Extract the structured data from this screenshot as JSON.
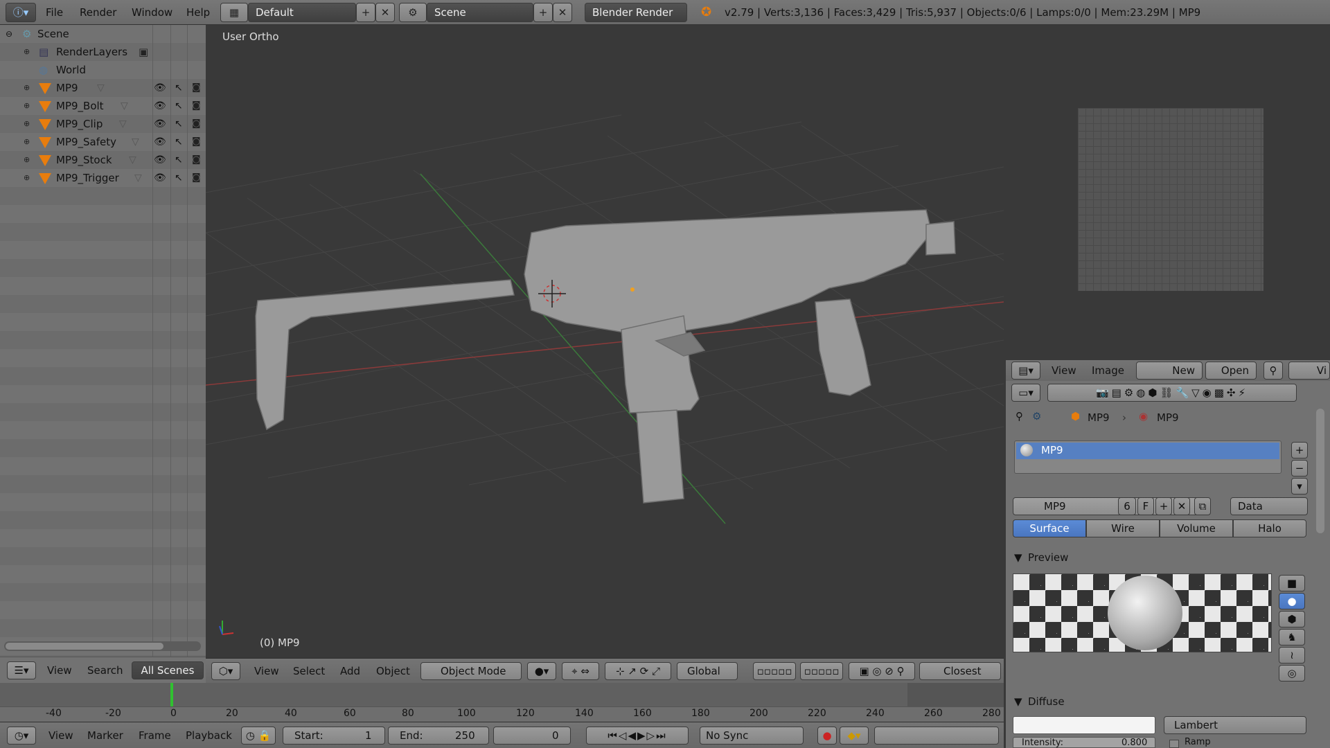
{
  "menu": {
    "file": "File",
    "render": "Render",
    "window": "Window",
    "help": "Help"
  },
  "layout": {
    "name": "Default"
  },
  "scene": {
    "name": "Scene"
  },
  "engine": {
    "name": "Blender Render"
  },
  "stats": "v2.79 | Verts:3,136 | Faces:3,429 | Tris:5,937 | Objects:0/6 | Lamps:0/0 | Mem:23.29M | MP9",
  "outliner": {
    "items": [
      {
        "label": "Scene"
      },
      {
        "label": "RenderLayers"
      },
      {
        "label": "World"
      },
      {
        "label": "MP9"
      },
      {
        "label": "MP9_Bolt"
      },
      {
        "label": "MP9_Clip"
      },
      {
        "label": "MP9_Safety"
      },
      {
        "label": "MP9_Stock"
      },
      {
        "label": "MP9_Trigger"
      }
    ],
    "footer": {
      "view": "View",
      "search": "Search",
      "filter": "All Scenes"
    }
  },
  "viewport": {
    "view_name": "User Ortho",
    "object_label": "(0) MP9",
    "header": {
      "view": "View",
      "select": "Select",
      "add": "Add",
      "object": "Object",
      "mode": "Object Mode",
      "orientation": "Global",
      "snap": "Closest"
    }
  },
  "image_editor": {
    "view": "View",
    "image": "Image",
    "new": "New",
    "open": "Open",
    "vi": "Vi"
  },
  "properties": {
    "breadcrumb_object": "MP9",
    "breadcrumb_material": "MP9",
    "material_slot": "MP9",
    "material_name": "MP9",
    "users": "6",
    "fake": "F",
    "link": "Data",
    "tabs": [
      "Surface",
      "Wire",
      "Volume",
      "Halo"
    ],
    "preview_title": "Preview",
    "diffuse_title": "Diffuse",
    "diffuse_shader": "Lambert",
    "intensity_label": "Intensity:",
    "intensity_value": "0.800",
    "ramp_label": "Ramp"
  },
  "timeline": {
    "ticks": [
      "-40",
      "-20",
      "0",
      "20",
      "40",
      "60",
      "80",
      "100",
      "120",
      "140",
      "160",
      "180",
      "200",
      "220",
      "240",
      "260",
      "280"
    ],
    "view": "View",
    "marker": "Marker",
    "frame": "Frame",
    "playback": "Playback",
    "start_label": "Start:",
    "start": "1",
    "end_label": "End:",
    "end": "250",
    "current": "0",
    "sync": "No Sync"
  }
}
